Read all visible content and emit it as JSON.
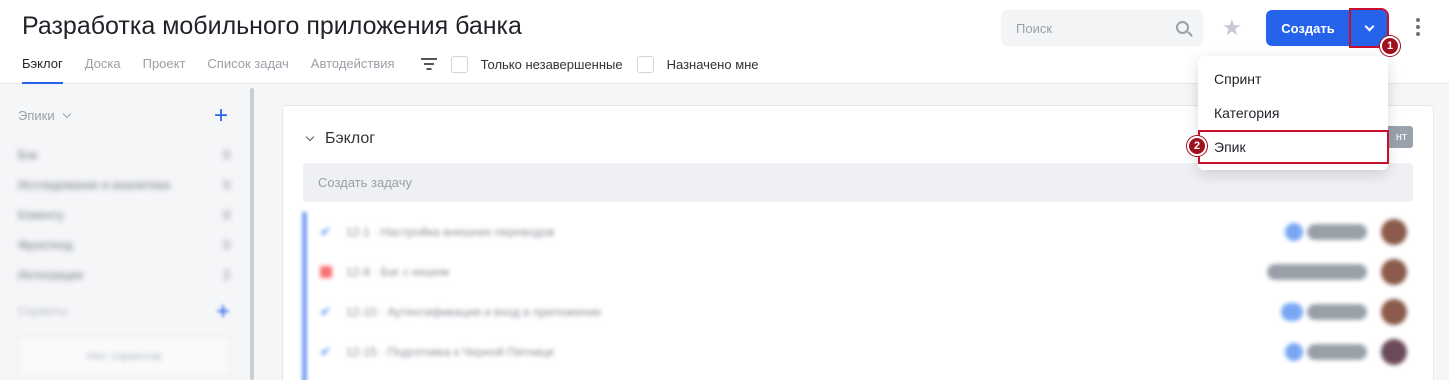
{
  "header": {
    "title": "Разработка мобильного приложения банка",
    "tabs": [
      "Бэклог",
      "Доска",
      "Проект",
      "Список задач",
      "Автодействия"
    ],
    "filters": {
      "only_unfinished": "Только незавершенные",
      "assigned_to_me": "Назначено мне"
    },
    "search": {
      "placeholder": "Поиск"
    },
    "create_label": "Создать"
  },
  "dropdown": {
    "items": [
      "Спринт",
      "Категория",
      "Эпик"
    ]
  },
  "markers": [
    "1",
    "2"
  ],
  "sidebar": {
    "epics_label": "Эпики",
    "epics": [
      {
        "name": "Бэк",
        "count": "0"
      },
      {
        "name": "Исследование и аналитика",
        "count": "0"
      },
      {
        "name": "Клиенту",
        "count": "0"
      },
      {
        "name": "Фронтенд",
        "count": "0"
      },
      {
        "name": "Интеграции",
        "count": "2"
      }
    ],
    "sprints_label": "Спринты",
    "no_sprints": "Нет спринтов"
  },
  "main": {
    "backlog_label": "Бэклог",
    "sprint_btn": "нт",
    "create_task_placeholder": "Создать задачу",
    "tasks": [
      {
        "text": "12-1 · Настройка внешних переводов"
      },
      {
        "text": "12-8 · Баг с кешем"
      },
      {
        "text": "12-10 · Аутентификация и вход в приложение"
      },
      {
        "text": "12-15 · Подготовка к Черной Пятнице"
      }
    ]
  }
}
